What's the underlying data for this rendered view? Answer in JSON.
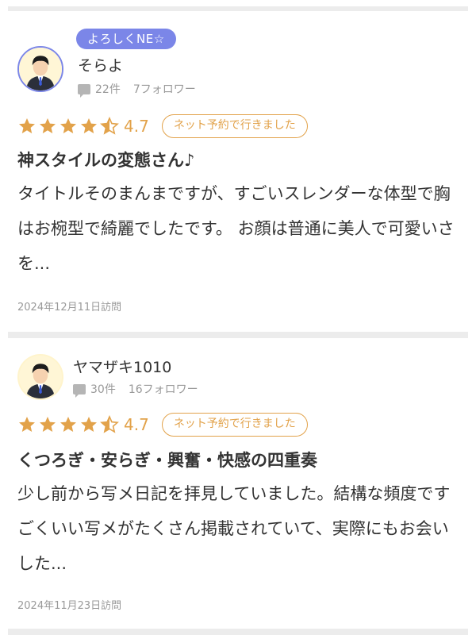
{
  "reviews": [
    {
      "badge": "よろしくNE☆",
      "name": "そらよ",
      "posts": "22件",
      "followers": "7フォロワー",
      "rating": "4.7",
      "rating_value": 4.7,
      "tag": "ネット予約で行きました",
      "title": "神スタイルの変態さん♪",
      "body": "タイトルそのまんまですが、すごいスレンダーな体型で胸はお椀型で綺麗でしたです。 お顔は普通に美人で可愛いさを...",
      "date": "2024年12月11日訪問"
    },
    {
      "name": "ヤマザキ1010",
      "posts": "30件",
      "followers": "16フォロワー",
      "rating": "4.7",
      "rating_value": 4.7,
      "tag": "ネット予約で行きました",
      "title": "くつろぎ・安らぎ・興奮・快感の四重奏",
      "body": "少し前から写メ日記を拝見していました。結構な頻度ですごくいい写メがたくさん掲載されていて、実際にもお会いした...",
      "date": "2024年11月23日訪問"
    }
  ],
  "colors": {
    "accent": "#e2a24a",
    "badge": "#7b86e8",
    "separator": "#ececec",
    "muted": "#999999"
  },
  "icons": {
    "star": "star-icon",
    "half_star": "half-star-icon",
    "comment": "comment-icon",
    "avatar": "user-avatar"
  }
}
